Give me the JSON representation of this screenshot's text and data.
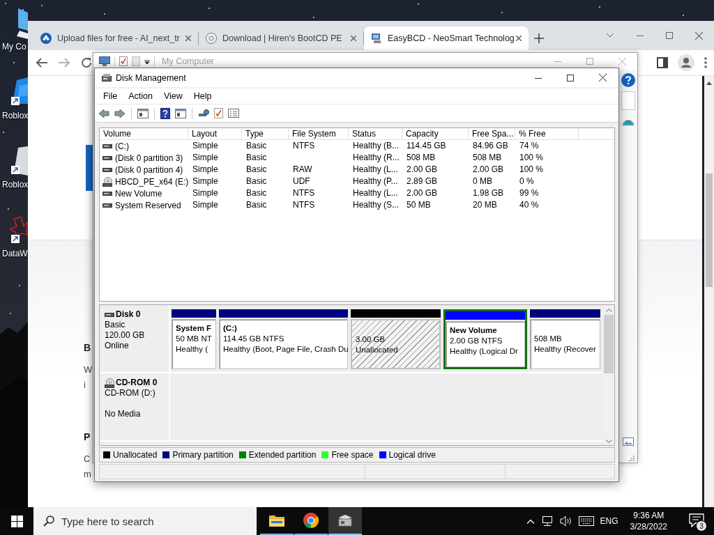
{
  "desktop": {
    "icons": [
      {
        "label": "My Co",
        "kind": "computer"
      },
      {
        "label": "Roblox",
        "kind": "tile"
      },
      {
        "label": "Roblox",
        "kind": "tile_grey"
      },
      {
        "label": "DataW",
        "kind": "star"
      }
    ]
  },
  "browser": {
    "tabs": [
      {
        "title": "Upload files for free - AI_next_tr",
        "kind": "cloud",
        "selected": false
      },
      {
        "title": "Download | Hiren's BootCD PE",
        "kind": "disc",
        "selected": false
      },
      {
        "title": "EasyBCD - NeoSmart Technolog",
        "kind": "computer",
        "selected": true
      }
    ],
    "page_fragments": [
      {
        "text": "B",
        "kind": "heading"
      },
      {
        "text": "W",
        "kind": "body"
      },
      {
        "text": "i",
        "kind": "body"
      },
      {
        "text": "P",
        "kind": "heading"
      },
      {
        "text": "C",
        "kind": "body"
      },
      {
        "text": "m",
        "kind": "body"
      }
    ]
  },
  "my_computer": {
    "title": "My Computer"
  },
  "disk_management": {
    "title": "Disk Management",
    "menu": [
      "File",
      "Action",
      "View",
      "Help"
    ],
    "columns": [
      "Volume",
      "Layout",
      "Type",
      "File System",
      "Status",
      "Capacity",
      "Free Spa...",
      "% Free"
    ],
    "volumes": [
      {
        "kind": "drive",
        "volume": "(C:)",
        "layout": "Simple",
        "type": "Basic",
        "file_system": "NTFS",
        "status": "Healthy (B...",
        "capacity": "114.45 GB",
        "free_space": "84.96 GB",
        "percent_free": "74 %"
      },
      {
        "kind": "drive",
        "volume": "(Disk 0 partition 3)",
        "layout": "Simple",
        "type": "Basic",
        "status": "Healthy (R...",
        "capacity": "508 MB",
        "free_space": "508 MB",
        "percent_free": "100 %"
      },
      {
        "kind": "drive",
        "volume": "(Disk 0 partition 4)",
        "layout": "Simple",
        "type": "Basic",
        "file_system": "RAW",
        "status": "Healthy (L...",
        "capacity": "2.00 GB",
        "free_space": "2.00 GB",
        "percent_free": "100 %"
      },
      {
        "kind": "cd",
        "volume": "HBCD_PE_x64 (E:)",
        "layout": "Simple",
        "type": "Basic",
        "file_system": "UDF",
        "status": "Healthy (P...",
        "capacity": "2.89 GB",
        "free_space": "0 MB",
        "percent_free": "0 %"
      },
      {
        "kind": "drive",
        "volume": "New Volume",
        "layout": "Simple",
        "type": "Basic",
        "file_system": "NTFS",
        "status": "Healthy (L...",
        "capacity": "2.00 GB",
        "free_space": "1.98 GB",
        "percent_free": "99 %"
      },
      {
        "kind": "drive",
        "volume": "System Reserved",
        "layout": "Simple",
        "type": "Basic",
        "file_system": "NTFS",
        "status": "Healthy (S...",
        "capacity": "50 MB",
        "free_space": "20 MB",
        "percent_free": "40 %"
      }
    ],
    "disks": [
      {
        "kind": "disk",
        "name": "Disk 0",
        "type": "Basic",
        "size": "120.00 GB",
        "status": "Online",
        "partitions": [
          {
            "kind": "primary",
            "name": "System F",
            "size": "50 MB NT",
            "status": "Healthy (",
            "selected": false
          },
          {
            "kind": "primary",
            "name": "(C:)",
            "size": "114.45 GB NTFS",
            "status": "Healthy (Boot, Page File, Crash Du",
            "selected": false
          },
          {
            "kind": "unallocated",
            "size": "3.00 GB",
            "status": "Unallocated",
            "selected": false
          },
          {
            "kind": "logical",
            "name": "New Volume",
            "size": "2.00 GB NTFS",
            "status": "Healthy (Logical Dr",
            "selected": true
          },
          {
            "kind": "primary",
            "size": "508 MB",
            "status": "Healthy (Recover",
            "selected": false
          }
        ]
      },
      {
        "kind": "cdrom",
        "name": "CD-ROM 0",
        "type": "CD-ROM (D:)",
        "status": "No Media"
      }
    ],
    "legend": [
      {
        "label": "Unallocated",
        "color": "#000000"
      },
      {
        "label": "Primary partition",
        "color": "#000080"
      },
      {
        "label": "Extended partition",
        "color": "#008000"
      },
      {
        "label": "Free space",
        "color": "#33ff33"
      },
      {
        "label": "Logical drive",
        "color": "#0000ff"
      }
    ]
  },
  "taskbar": {
    "search": {
      "placeholder": "Type here to search"
    },
    "apps": [
      {
        "kind": "folder",
        "active": false
      },
      {
        "kind": "chrome",
        "active": false
      },
      {
        "kind": "tool",
        "active": true
      }
    ],
    "language": "ENG",
    "time": "9:36 AM",
    "date": "3/28/2022",
    "notifications": "3"
  }
}
